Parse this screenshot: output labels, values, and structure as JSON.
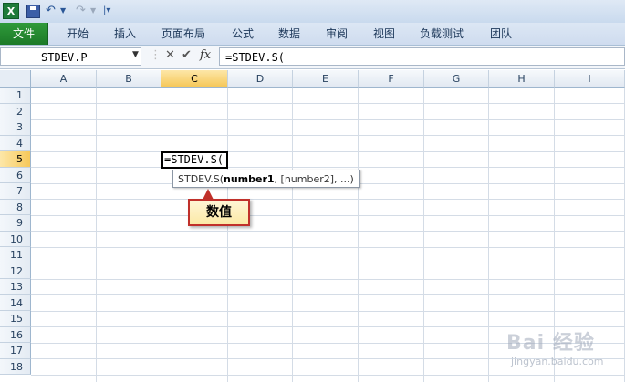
{
  "quick_access": {
    "app_icon": "X"
  },
  "ribbon": {
    "tabs": [
      "文件",
      "开始",
      "插入",
      "页面布局",
      "公式",
      "数据",
      "审阅",
      "视图",
      "负载测试",
      "团队"
    ]
  },
  "formula_bar": {
    "name_box": "STDEV.P",
    "fx_label": "fx",
    "formula": "=STDEV.S("
  },
  "grid": {
    "columns": [
      "A",
      "B",
      "C",
      "D",
      "E",
      "F",
      "G",
      "H",
      "I"
    ],
    "rows": [
      "1",
      "2",
      "3",
      "4",
      "5",
      "6",
      "7",
      "8",
      "9",
      "10",
      "11",
      "12",
      "13",
      "14",
      "15",
      "16",
      "17",
      "18"
    ],
    "active_column": "C",
    "active_row": "5",
    "active_cell_text": "=STDEV.S("
  },
  "tooltip": {
    "function_name": "STDEV.S(",
    "current_arg": "number1",
    "rest": ", [number2], ...)"
  },
  "callout": {
    "text": "数值"
  },
  "watermark": {
    "text": "Bai 经验",
    "sub": "jingyan.baidu.com"
  }
}
